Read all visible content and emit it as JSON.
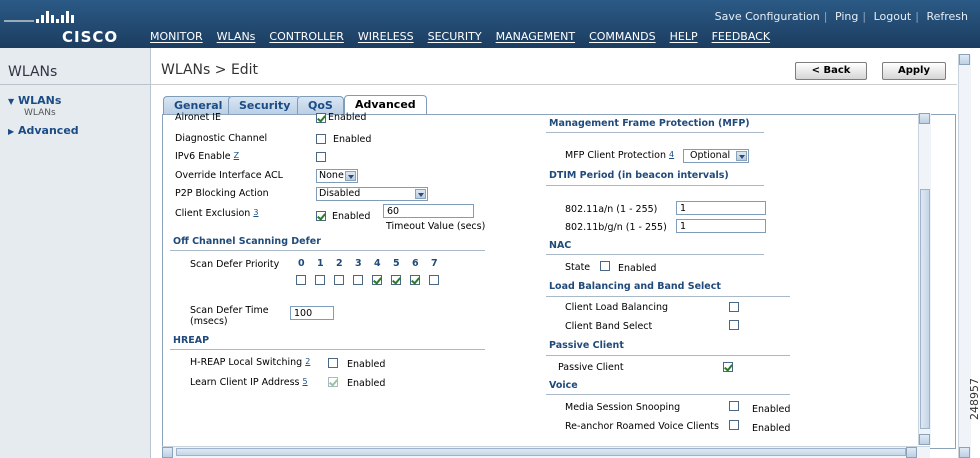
{
  "header": {
    "logo_text": "CISCO",
    "top_links": [
      "Save Configuration",
      "Ping",
      "Logout",
      "Refresh"
    ],
    "main_nav": [
      "MONITOR",
      "WLANs",
      "CONTROLLER",
      "WIRELESS",
      "SECURITY",
      "MANAGEMENT",
      "COMMANDS",
      "HELP",
      "FEEDBACK"
    ]
  },
  "sidebar": {
    "title": "WLANs",
    "items": [
      {
        "label": "WLANs",
        "sub": "WLANs"
      },
      {
        "label": "Advanced"
      }
    ]
  },
  "page": {
    "breadcrumb": "WLANs > Edit",
    "back_label": "< Back",
    "apply_label": "Apply"
  },
  "tabs": [
    "General",
    "Security",
    "QoS",
    "Advanced"
  ],
  "left": {
    "aironet_ie": "Aironet IE",
    "aironet_enabled": "Enabled",
    "diag_channel": "Diagnostic Channel",
    "diag_enabled": "Enabled",
    "ipv6_enable": "IPv6 Enable",
    "ipv6_sup": "Z",
    "override_acl": "Override Interface ACL",
    "override_value": "None",
    "p2p_action": "P2P Blocking Action",
    "p2p_value": "Disabled",
    "client_exclusion": "Client Exclusion",
    "client_exclusion_sup": "3",
    "exclusion_enabled": "Enabled",
    "timeout_value": "60",
    "timeout_label": "Timeout Value (secs)",
    "off_channel_heading": "Off Channel Scanning Defer",
    "scan_defer_priority": "Scan Defer Priority",
    "priorities": [
      "0",
      "1",
      "2",
      "3",
      "4",
      "5",
      "6",
      "7"
    ],
    "priority_checked": [
      false,
      false,
      false,
      false,
      true,
      true,
      true,
      false
    ],
    "scan_defer_time": "Scan Defer Time",
    "scan_defer_time_unit": "(msecs)",
    "scan_defer_time_value": "100",
    "hreap_heading": "HREAP",
    "hreap_local_switching": "H-REAP Local Switching",
    "hreap_sup": "2",
    "hreap_enabled": "Enabled",
    "learn_client_ip": "Learn Client IP Address",
    "learn_sup": "5",
    "learn_enabled": "Enabled"
  },
  "right": {
    "mfp_heading": "Management Frame Protection (MFP)",
    "mfp_client_protection": "MFP Client Protection",
    "mfp_sup": "4",
    "mfp_value": "Optional",
    "dtim_heading": "DTIM Period (in beacon intervals)",
    "dtim_a": "802.11a/n (1 - 255)",
    "dtim_a_value": "1",
    "dtim_b": "802.11b/g/n (1 - 255)",
    "dtim_b_value": "1",
    "nac_heading": "NAC",
    "nac_state": "State",
    "nac_enabled": "Enabled",
    "lb_heading": "Load Balancing and Band Select",
    "client_lb": "Client Load Balancing",
    "client_band": "Client Band Select",
    "passive_heading": "Passive Client",
    "passive_client": "Passive Client",
    "voice_heading": "Voice",
    "media_snooping": "Media Session Snooping",
    "media_enabled": "Enabled",
    "reanchor": "Re-anchor Roamed Voice Clients",
    "reanchor_enabled": "Enabled"
  },
  "watermark": "248957"
}
